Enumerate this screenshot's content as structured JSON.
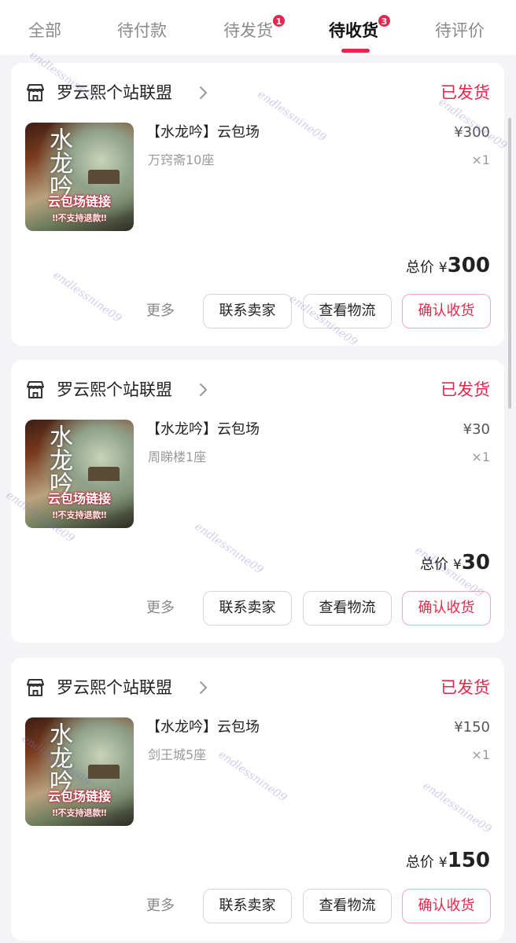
{
  "tabs": [
    {
      "label": "全部",
      "badge": null
    },
    {
      "label": "待付款",
      "badge": null
    },
    {
      "label": "待发货",
      "badge": "1"
    },
    {
      "label": "待收货",
      "badge": "3"
    },
    {
      "label": "待评价",
      "badge": null
    }
  ],
  "active_tab": "待收货",
  "orders": [
    {
      "shop_name": "罗云熙个站联盟",
      "status": "已发货",
      "product_name": "【水龙吟】云包场",
      "spec": "万窍斋10座",
      "unit_price": "¥300",
      "quantity": "×1",
      "total_label": "总价",
      "total_currency": "¥",
      "total_value": "300",
      "thumb_title": "水龙吟",
      "thumb_banner": "云包场链接",
      "thumb_note": "‼不支持退款‼",
      "more_label": "更多",
      "contact_label": "联系卖家",
      "logistics_label": "查看物流",
      "confirm_label": "确认收货"
    },
    {
      "shop_name": "罗云熙个站联盟",
      "status": "已发货",
      "product_name": "【水龙吟】云包场",
      "spec": "周睇楼1座",
      "unit_price": "¥30",
      "quantity": "×1",
      "total_label": "总价",
      "total_currency": "¥",
      "total_value": "30",
      "thumb_title": "水龙吟",
      "thumb_banner": "云包场链接",
      "thumb_note": "‼不支持退款‼",
      "more_label": "更多",
      "contact_label": "联系卖家",
      "logistics_label": "查看物流",
      "confirm_label": "确认收货"
    },
    {
      "shop_name": "罗云熙个站联盟",
      "status": "已发货",
      "product_name": "【水龙吟】云包场",
      "spec": "剑王城5座",
      "unit_price": "¥150",
      "quantity": "×1",
      "total_label": "总价",
      "total_currency": "¥",
      "total_value": "150",
      "thumb_title": "水龙吟",
      "thumb_banner": "云包场链接",
      "thumb_note": "‼不支持退款‼",
      "more_label": "更多",
      "contact_label": "联系卖家",
      "logistics_label": "查看物流",
      "confirm_label": "确认收货"
    }
  ],
  "watermark_text": "endlessnine09",
  "colors": {
    "accent": "#e8264b",
    "background": "#f4f4f6",
    "card": "#ffffff",
    "muted": "#999999"
  }
}
